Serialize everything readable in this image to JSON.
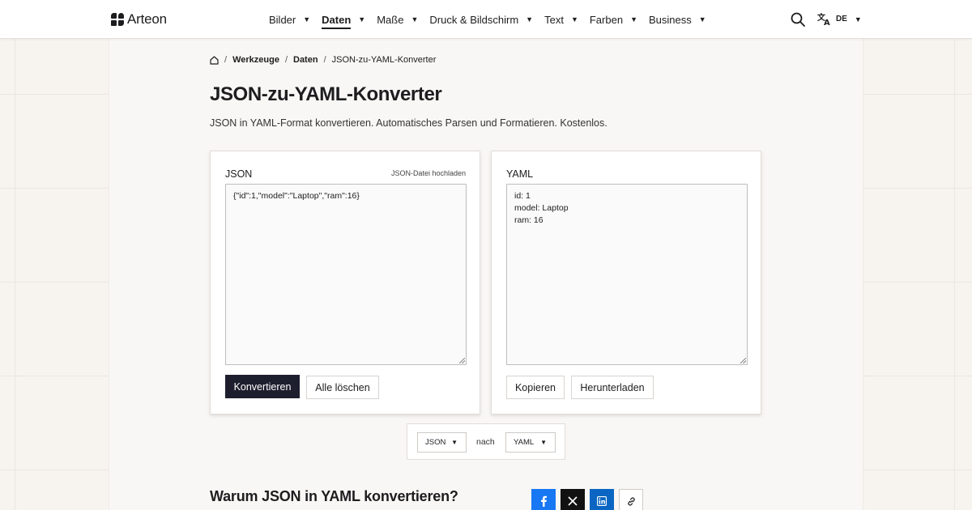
{
  "header": {
    "brand": "Arteon",
    "nav": [
      {
        "label": "Bilder",
        "active": false
      },
      {
        "label": "Daten",
        "active": true
      },
      {
        "label": "Maße",
        "active": false
      },
      {
        "label": "Druck & Bildschirm",
        "active": false
      },
      {
        "label": "Text",
        "active": false
      },
      {
        "label": "Farben",
        "active": false
      },
      {
        "label": "Business",
        "active": false
      }
    ],
    "search_icon": "search-icon",
    "language": "DE",
    "translate_icon": "translate-icon"
  },
  "breadcrumb": {
    "home_icon": "home-icon",
    "items": [
      "Werkzeuge",
      "Daten",
      "JSON-zu-YAML-Konverter"
    ]
  },
  "page": {
    "title": "JSON-zu-YAML-Konverter",
    "subtitle": "JSON in YAML-Format konvertieren. Automatisches Parsen und Formatieren. Kostenlos."
  },
  "input_card": {
    "title": "JSON",
    "upload_label": "JSON-Datei hochladen",
    "value": "{\"id\":1,\"model\":\"Laptop\",\"ram\":16}",
    "convert_label": "Konvertieren",
    "clear_label": "Alle löschen"
  },
  "output_card": {
    "title": "YAML",
    "value": "id: 1\nmodel: Laptop\nram: 16",
    "copy_label": "Kopieren",
    "download_label": "Herunterladen"
  },
  "format_switcher": {
    "from": "JSON",
    "connector": "nach",
    "to": "YAML"
  },
  "section": {
    "heading": "Warum JSON in YAML konvertieren?"
  },
  "share": {
    "icons": [
      "facebook-icon",
      "x-icon",
      "linkedin-icon",
      "link-icon"
    ],
    "colors": {
      "facebook": "#1877f2",
      "x": "#111111",
      "linkedin": "#0a66c2"
    }
  },
  "colors": {
    "primary_button": "#1d1f2e",
    "background": "#f7f3ef",
    "card": "#ffffff"
  }
}
